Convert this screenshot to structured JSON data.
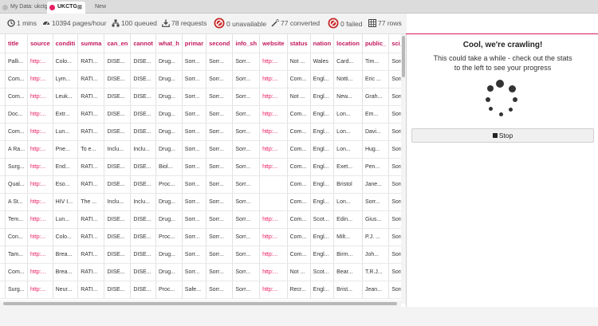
{
  "tabs": [
    {
      "label": "My Data: ukctg",
      "active": false
    },
    {
      "label": "UKCTG",
      "active": true,
      "close": "⊠"
    },
    {
      "label": "New",
      "active": false
    }
  ],
  "stats": {
    "time": "1 mins",
    "rate": "10394 pages/hour",
    "queued": "100 queued",
    "requests": "78 requests",
    "unavailable": "0 unavailable",
    "converted": "77 converted",
    "failed": "0 failed",
    "rows": "77 rows"
  },
  "columns": [
    "",
    "title",
    "source",
    "conditi",
    "summa",
    "can_en",
    "cannot",
    "what_h",
    "primar",
    "second",
    "info_sh",
    "website",
    "status",
    "nation",
    "location",
    "public_",
    "sci_cor"
  ],
  "rows": [
    [
      "",
      "Palli...",
      "http:...",
      "Colo...",
      "RATI...",
      "DISE...",
      "DISE...",
      "Drug...",
      "Sorr...",
      "Sorr...",
      "Sorr...",
      "http:...",
      "Not ...",
      "Wales",
      "Card...",
      "Tim...",
      "Sorr..."
    ],
    [
      "",
      "Com...",
      "http:...",
      "Lym...",
      "RATI...",
      "DISE...",
      "DISE...",
      "Drug...",
      "Sorr...",
      "Sorr...",
      "Sorr...",
      "http:...",
      "Com...",
      "Engl...",
      "Notti...",
      "Eric ...",
      "Sorr..."
    ],
    [
      "",
      "Com...",
      "http:...",
      "Leuk...",
      "RATI...",
      "DISE...",
      "DISE...",
      "Drug...",
      "Sorr...",
      "Sorr...",
      "Sorr...",
      "http:...",
      "Not ...",
      "Engl...",
      "New...",
      "Grah...",
      "Sorr..."
    ],
    [
      "",
      "Doc...",
      "http:...",
      "Extr...",
      "RATI...",
      "DISE...",
      "DISE...",
      "Drug...",
      "Sorr...",
      "Sorr...",
      "Sorr...",
      "http:...",
      "Com...",
      "Engl...",
      "Lon...",
      "Em...",
      "Sorr..."
    ],
    [
      "",
      "Com...",
      "http:...",
      "Lun...",
      "RATI...",
      "DISE...",
      "DISE...",
      "Drug...",
      "Sorr...",
      "Sorr...",
      "Sorr...",
      "http:...",
      "Com...",
      "Engl...",
      "Lon...",
      "Davi...",
      "Sorr..."
    ],
    [
      "",
      "A Ra...",
      "http:...",
      "Pne...",
      "To e...",
      "Inclu...",
      "Inclu...",
      "Drug...",
      "Sorr...",
      "Sorr...",
      "Sorr...",
      "http:...",
      "Com...",
      "Engl...",
      "Lon...",
      "Hug...",
      "Sorr..."
    ],
    [
      "",
      "Surg...",
      "http:...",
      "End...",
      "RATI...",
      "DISE...",
      "DISE...",
      "Biol...",
      "Sorr...",
      "Sorr...",
      "Sorr...",
      "http:...",
      "Com...",
      "Engl...",
      "Exet...",
      "Pen...",
      "Sorr..."
    ],
    [
      "",
      "Qual...",
      "http:...",
      "Eso...",
      "RATI...",
      "DISE...",
      "DISE...",
      "Proc...",
      "Sorr...",
      "Sorr...",
      "Sorr...",
      "",
      "Com...",
      "Engl...",
      "Bristol",
      "Jane...",
      "Sorr..."
    ],
    [
      "",
      "A St...",
      "http:...",
      "HIV I...",
      "The ...",
      "Inclu...",
      "Inclu...",
      "Drug...",
      "Sorr...",
      "Sorr...",
      "Sorr...",
      "",
      "Com...",
      "Engl...",
      "Lon...",
      "Sorr...",
      "Sorr..."
    ],
    [
      "",
      "Tem...",
      "http:...",
      "Lun...",
      "RATI...",
      "DISE...",
      "DISE...",
      "Drug...",
      "Sorr...",
      "Sorr...",
      "Sorr...",
      "http:...",
      "Com...",
      "Scot...",
      "Edin...",
      "Gius...",
      "Sorr..."
    ],
    [
      "",
      "Con...",
      "http:...",
      "Colo...",
      "RATI...",
      "DISE...",
      "DISE...",
      "Proc...",
      "Sorr...",
      "Sorr...",
      "Sorr...",
      "http:...",
      "Com...",
      "Engl...",
      "Milt...",
      "P.J. ...",
      "Sorr..."
    ],
    [
      "",
      "Tam...",
      "http:...",
      "Brea...",
      "RATI...",
      "DISE...",
      "DISE...",
      "Drug...",
      "Sorr...",
      "Sorr...",
      "Sorr...",
      "http:...",
      "Com...",
      "Engl...",
      "Birm...",
      "Joh...",
      "Sorr..."
    ],
    [
      "",
      "Com...",
      "http:...",
      "Brea...",
      "RATI...",
      "DISE...",
      "DISE...",
      "Drug...",
      "Sorr...",
      "Sorr...",
      "Sorr...",
      "http:...",
      "Not ...",
      "Scot...",
      "Bear...",
      "T.R.J...",
      "Sorr..."
    ],
    [
      "",
      "Surg...",
      "http:...",
      "Neur...",
      "RATI...",
      "DISE...",
      "DISE...",
      "Proc...",
      "Safe...",
      "Sorr...",
      "Sorr...",
      "http:...",
      "Recr...",
      "Engl...",
      "Brist...",
      "Jean...",
      "Sorr..."
    ]
  ],
  "panel": {
    "title": "Cool, we're crawling!",
    "subtitle": "This could take a while - check out the stats to the left to see your progress",
    "stop_label": "Stop"
  },
  "colors": {
    "accent": "#d81b60",
    "link": "#e91e63",
    "fail": "#c62828"
  }
}
